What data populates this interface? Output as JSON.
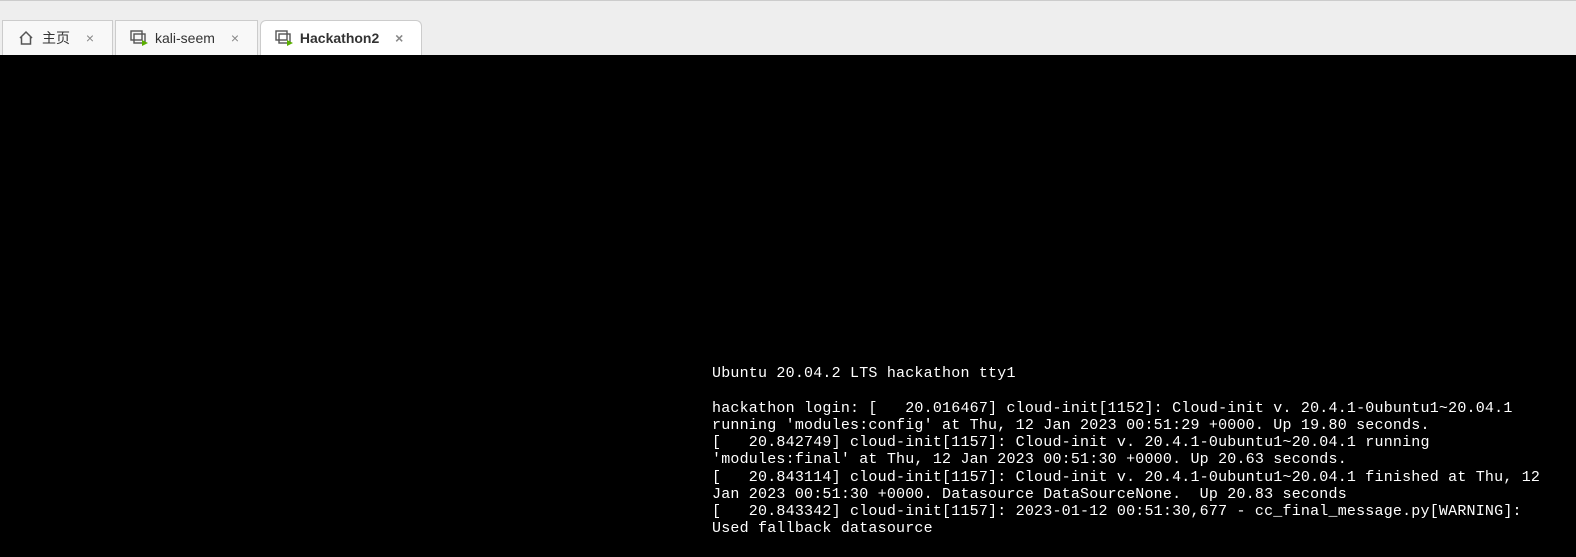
{
  "tabs": [
    {
      "label": "主页",
      "icon": "home",
      "active": false
    },
    {
      "label": "kali-seem",
      "icon": "vm",
      "active": false
    },
    {
      "label": "Hackathon2",
      "icon": "vm",
      "active": true
    }
  ],
  "console": {
    "banner": "Ubuntu 20.04.2 LTS hackathon tty1",
    "lines": [
      "hackathon login: [   20.016467] cloud-init[1152]: Cloud-init v. 20.4.1-0ubuntu1~20.04.1 running 'modules:config' at Thu, 12 Jan 2023 00:51:29 +0000. Up 19.80 seconds.",
      "[   20.842749] cloud-init[1157]: Cloud-init v. 20.4.1-0ubuntu1~20.04.1 running 'modules:final' at Thu, 12 Jan 2023 00:51:30 +0000. Up 20.63 seconds.",
      "[   20.843114] cloud-init[1157]: Cloud-init v. 20.4.1-0ubuntu1~20.04.1 finished at Thu, 12 Jan 2023 00:51:30 +0000. Datasource DataSourceNone.  Up 20.83 seconds",
      "[   20.843342] cloud-init[1157]: 2023-01-12 00:51:30,677 - cc_final_message.py[WARNING]: Used fallback datasource"
    ]
  }
}
